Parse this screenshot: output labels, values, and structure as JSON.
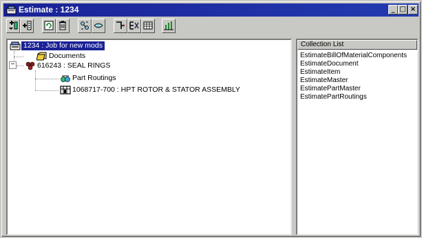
{
  "window": {
    "title": "Estimate : 1234"
  },
  "caption_buttons": [
    "_",
    "□",
    "×"
  ],
  "toolbar": {
    "buttons": [
      {
        "icon": "insert-before-icon"
      },
      {
        "icon": "insert-after-icon"
      },
      {
        "icon": "refresh-icon"
      },
      {
        "icon": "delete-icon"
      },
      {
        "icon": "expand-icon"
      },
      {
        "icon": "collapse-icon"
      },
      {
        "icon": "route-icon"
      },
      {
        "icon": "route-list-icon"
      },
      {
        "icon": "grid-icon"
      },
      {
        "icon": "chart-icon"
      }
    ]
  },
  "tree": {
    "root": {
      "label": "1234 : Job for new mods"
    },
    "documents": {
      "label": "Documents"
    },
    "part": {
      "label": "616243 : SEAL RINGS",
      "expander": "−"
    },
    "routings": {
      "label": "Part Routings"
    },
    "assembly": {
      "label": "1068717-700 : HPT ROTOR & STATOR ASSEMBLY"
    }
  },
  "collection_list": {
    "header": "Collection List",
    "items": [
      "EstimateBillOfMaterialComponents",
      "EstimateDocument",
      "EstimateItem",
      "EstimateMaster",
      "EstimatePartMaster",
      "EstimatePartRoutings"
    ]
  },
  "colors": {
    "title_start": "#1a2296",
    "title_end": "#233bb0",
    "selection": "#1a2296",
    "face": "#c8c8c4"
  }
}
